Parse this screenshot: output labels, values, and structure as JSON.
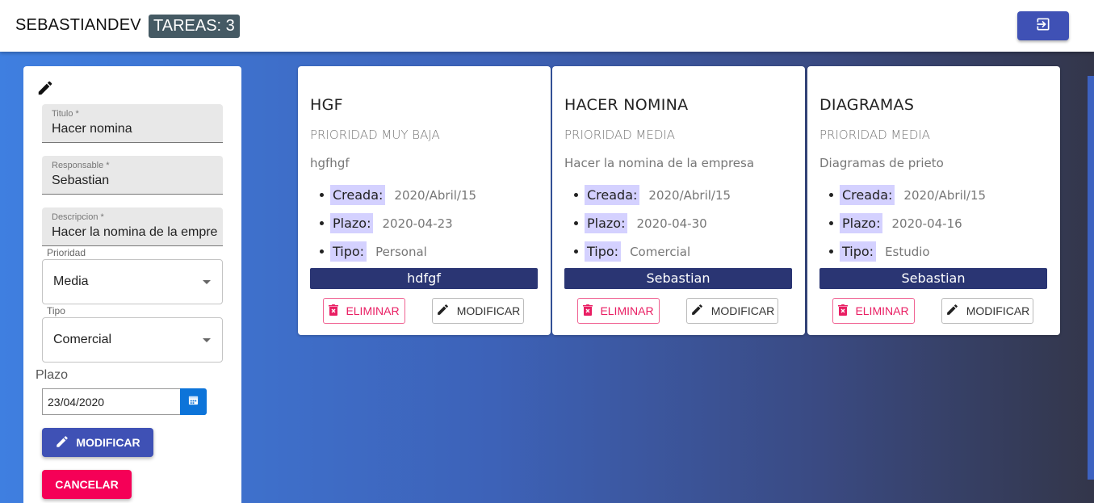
{
  "header": {
    "brand": "SEBASTIANDEV",
    "tasks_badge": "TAREAS: 3",
    "logout_icon": "exit-to-app-icon"
  },
  "form": {
    "header_icon": "pencil-icon",
    "titulo": {
      "label": "Titulo *",
      "value": "Hacer nomina"
    },
    "responsable": {
      "label": "Responsable *",
      "value": "Sebastian"
    },
    "descripcion": {
      "label": "Descripcion *",
      "value": "Hacer la nomina de la empresa"
    },
    "prioridad": {
      "label": "Prioridad",
      "value": "Media"
    },
    "tipo": {
      "label": "Tipo",
      "value": "Comercial"
    },
    "plazo": {
      "label": "Plazo",
      "value": "23/04/2020"
    },
    "modificar_label": "MODIFICAR",
    "cancelar_label": "CANCELAR"
  },
  "labels": {
    "creada": "Creada:",
    "plazo": "Plazo:",
    "tipo": "Tipo:",
    "eliminar": "ELIMINAR",
    "modificar": "MODIFICAR"
  },
  "tasks": [
    {
      "title": "HGF",
      "priority": "PRIORIDAD MUY BAJA",
      "description": "hgfhgf",
      "created": "2020/Abril/15",
      "deadline": "2020-04-23",
      "type": "Personal",
      "owner": "hdfgf"
    },
    {
      "title": "HACER NOMINA",
      "priority": "PRIORIDAD MEDIA",
      "description": "Hacer la nomina de la empresa",
      "created": "2020/Abril/15",
      "deadline": "2020-04-30",
      "type": "Comercial",
      "owner": "Sebastian"
    },
    {
      "title": "DIAGRAMAS",
      "priority": "PRIORIDAD MEDIA",
      "description": "Diagramas de prieto",
      "created": "2020/Abril/15",
      "deadline": "2020-04-16",
      "type": "Estudio",
      "owner": "Sebastian"
    }
  ],
  "colors": {
    "primary": "#3f51b5",
    "secondary": "#f50057",
    "owner_bar": "#2a3573",
    "chip": "#d4d1ff",
    "badge": "#455a64"
  }
}
